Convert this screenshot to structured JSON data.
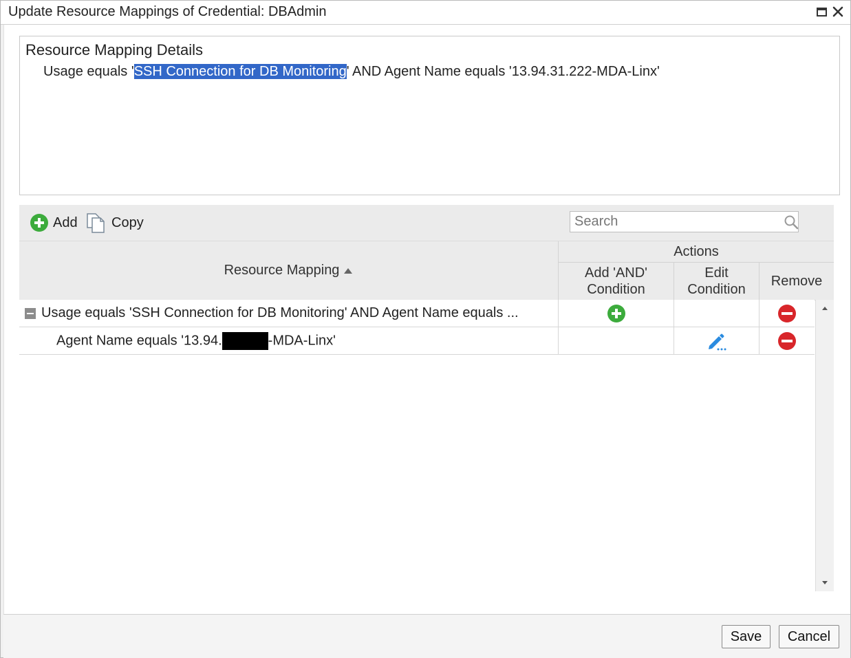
{
  "window": {
    "title": "Update Resource Mappings of Credential: DBAdmin",
    "maximize_icon": "maximize-icon",
    "close_icon": "close-icon"
  },
  "details": {
    "heading": "Resource Mapping Details",
    "text_before": "Usage equals '",
    "text_highlight": "SSH Connection for DB Monitoring",
    "text_after": "' AND Agent Name equals '13.94.31.222-MDA-Linx'"
  },
  "toolbar": {
    "add_label": "Add",
    "copy_label": "Copy",
    "search_placeholder": "Search"
  },
  "table": {
    "columns": {
      "resource_mapping": "Resource Mapping",
      "actions": "Actions",
      "add_and_line1": "Add 'AND'",
      "add_and_line2": "Condition",
      "edit_line1": "Edit",
      "edit_line2": "Condition",
      "remove": "Remove"
    },
    "rows": [
      {
        "text": "Usage equals 'SSH Connection for DB Monitoring' AND Agent Name equals ...",
        "expanded": true,
        "actions": [
          "add-condition-icon",
          "remove-icon"
        ]
      },
      {
        "text_before": "Agent Name equals '13.94.",
        "text_after": "-MDA-Linx'",
        "redacted": true,
        "actions": [
          "edit-icon",
          "remove-icon"
        ]
      }
    ]
  },
  "footer": {
    "save_label": "Save",
    "cancel_label": "Cancel"
  },
  "colors": {
    "highlight": "#3267c8",
    "add_green": "#3cab3c",
    "remove_red": "#d8262a",
    "edit_blue": "#2a8be0"
  }
}
